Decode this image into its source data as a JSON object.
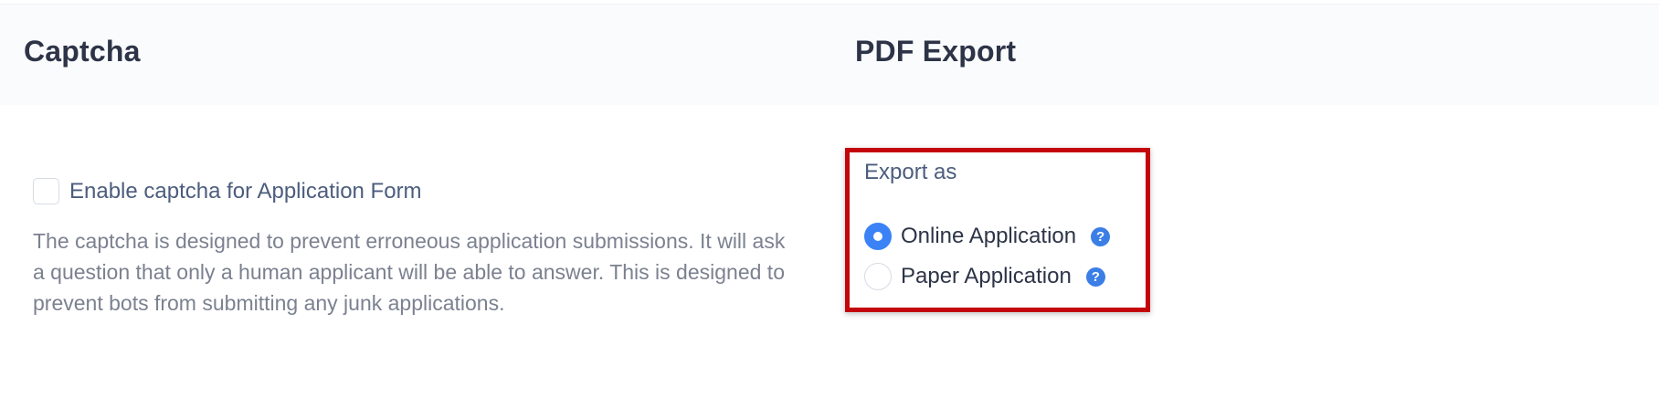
{
  "sections": {
    "captcha": {
      "title": "Captcha",
      "checkbox_label": "Enable captcha for Application Form",
      "checked": false,
      "description": "The captcha is designed to prevent erroneous application submissions. It will ask a question that only a human applicant will be able to answer. This is designed to prevent bots from submitting any junk applications."
    },
    "pdf_export": {
      "title": "PDF Export",
      "export_label": "Export as",
      "options": [
        {
          "label": "Online Application",
          "selected": true,
          "help_icon": "question-circle-icon",
          "help_glyph": "?"
        },
        {
          "label": "Paper Application",
          "selected": false,
          "help_icon": "question-circle-icon",
          "help_glyph": "?"
        }
      ]
    }
  },
  "colors": {
    "highlight_border": "#c4050c",
    "radio_selected": "#3b82f6",
    "help_icon": "#3b7fe6",
    "header_background": "#fafbfd"
  }
}
